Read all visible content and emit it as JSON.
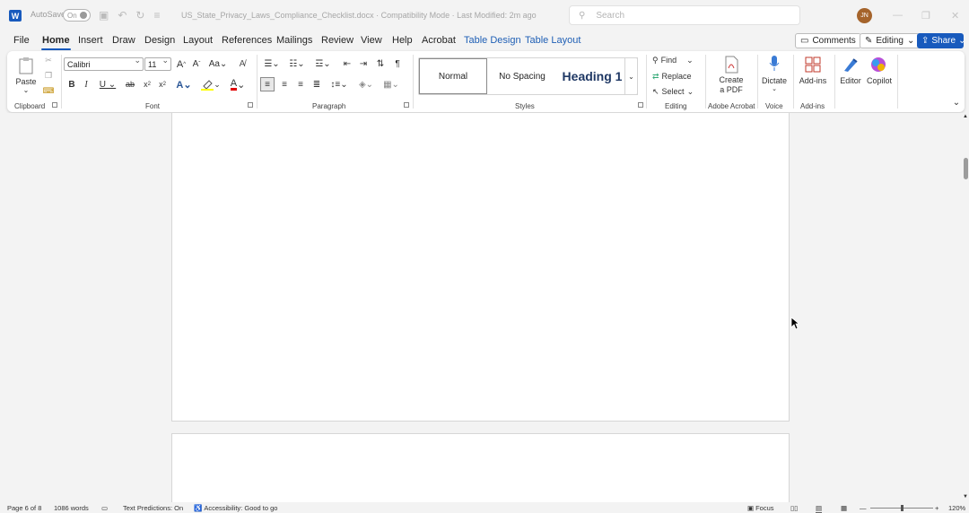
{
  "app": {
    "logo": "W",
    "autosave_label": "AutoSave",
    "autosave_state": "On",
    "title": "US_State_Privacy_Laws_Compliance_Checklist.docx  ·  Compatibility Mode  ·  Last Modified: 2m ago",
    "search_placeholder": "Search",
    "avatar_initials": "JN"
  },
  "menu": {
    "file": "File",
    "home": "Home",
    "insert": "Insert",
    "draw": "Draw",
    "design": "Design",
    "layout": "Layout",
    "references": "References",
    "mailings": "Mailings",
    "review": "Review",
    "view": "View",
    "help": "Help",
    "acrobat": "Acrobat",
    "table_design": "Table Design",
    "table_layout": "Table Layout"
  },
  "actions": {
    "comments": "Comments",
    "editing": "Editing",
    "share": "Share"
  },
  "ribbon": {
    "clipboard": {
      "label": "Clipboard",
      "paste": "Paste"
    },
    "font": {
      "label": "Font",
      "name": "Calibri",
      "size": "11"
    },
    "paragraph": {
      "label": "Paragraph"
    },
    "styles": {
      "label": "Styles",
      "normal": "Normal",
      "no_spacing": "No Spacing",
      "heading1": "Heading 1"
    },
    "editing": {
      "label": "Editing",
      "find": "Find",
      "replace": "Replace",
      "select": "Select"
    },
    "acrobat": {
      "label": "Adobe Acrobat",
      "create_pdf_1": "Create",
      "create_pdf_2": "a PDF"
    },
    "voice": {
      "label": "Voice",
      "dictate": "Dictate"
    },
    "addins": {
      "label": "Add-ins",
      "addins": "Add-ins"
    },
    "editor": "Editor",
    "copilot": "Copilot"
  },
  "status": {
    "page": "Page 6 of 8",
    "words": "1086 words",
    "predictions": "Text Predictions: On",
    "accessibility": "Accessibility: Good to go",
    "focus": "Focus",
    "zoom": "120%"
  },
  "colors": {
    "accent": "#185abd",
    "highlight": "#ffff00",
    "font_color": "#e00000"
  }
}
